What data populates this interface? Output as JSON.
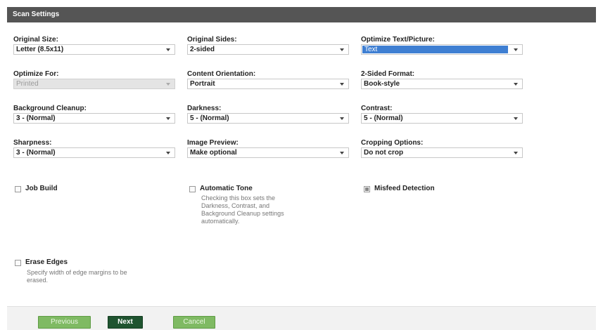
{
  "title": "Scan Settings",
  "fields": {
    "original_size": {
      "label": "Original Size:",
      "value": "Letter (8.5x11)"
    },
    "original_sides": {
      "label": "Original Sides:",
      "value": "2-sided"
    },
    "optimize_text_picture": {
      "label": "Optimize Text/Picture:",
      "value": "Text"
    },
    "optimize_for": {
      "label": "Optimize For:",
      "value": "Printed"
    },
    "content_orientation": {
      "label": "Content Orientation:",
      "value": "Portrait"
    },
    "two_sided_format": {
      "label": "2-Sided Format:",
      "value": "Book-style"
    },
    "background_cleanup": {
      "label": "Background Cleanup:",
      "value": "3 - (Normal)"
    },
    "darkness": {
      "label": "Darkness:",
      "value": "5 - (Normal)"
    },
    "contrast": {
      "label": "Contrast:",
      "value": "5 - (Normal)"
    },
    "sharpness": {
      "label": "Sharpness:",
      "value": "3 - (Normal)"
    },
    "image_preview": {
      "label": "Image Preview:",
      "value": "Make optional"
    },
    "cropping_options": {
      "label": "Cropping Options:",
      "value": "Do not crop"
    }
  },
  "checkboxes": {
    "job_build": {
      "label": "Job Build",
      "checked": false
    },
    "automatic_tone": {
      "label": "Automatic Tone",
      "checked": false,
      "hint_lines": [
        "Checking this box sets the",
        "Darkness, Contrast, and",
        "Background Cleanup settings",
        "automatically."
      ]
    },
    "misfeed_detection": {
      "label": "Misfeed Detection",
      "checked": true
    },
    "erase_edges": {
      "label": "Erase Edges",
      "checked": false,
      "hint_lines": [
        "Specify width of edge margins to be",
        "erased."
      ]
    }
  },
  "buttons": {
    "previous": "Previous",
    "next": "Next",
    "cancel": "Cancel"
  },
  "colors": {
    "title_bar": "#555555",
    "select_highlight": "#3f7fd2",
    "button_light_green": "#7fba63",
    "button_dark_green": "#1f5430"
  },
  "icons": {
    "dropdown": "chevron-down-icon",
    "checkbox": "checkbox-icon"
  }
}
